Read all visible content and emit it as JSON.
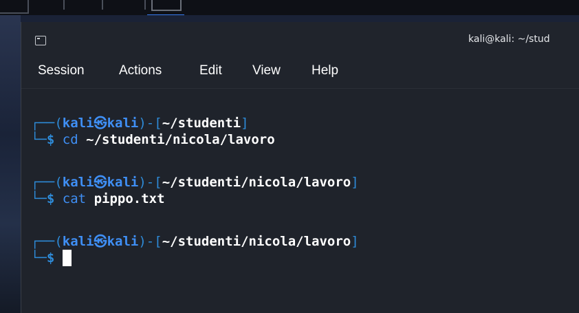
{
  "window": {
    "title": "kali@kali: ~/stud"
  },
  "menu": {
    "session": "Session",
    "actions": "Actions",
    "edit": "Edit",
    "view": "View",
    "help": "Help"
  },
  "terminal": {
    "prompts": [
      {
        "user": "kali",
        "at": "㉿",
        "host": "kali",
        "path": "~/studenti",
        "command": "cd",
        "argument": "~/studenti/nicola/lavoro"
      },
      {
        "user": "kali",
        "at": "㉿",
        "host": "kali",
        "path": "~/studenti/nicola/lavoro",
        "command": "cat",
        "argument": "pippo.txt"
      },
      {
        "user": "kali",
        "at": "㉿",
        "host": "kali",
        "path": "~/studenti/nicola/lavoro",
        "command": "",
        "argument": ""
      }
    ],
    "symbols": {
      "corner_top": "┌──",
      "corner_bottom": "└─",
      "open_paren": "(",
      "close_paren": ")",
      "dash": "-",
      "open_bracket": "[",
      "close_bracket": "]",
      "dollar": "$"
    }
  },
  "colors": {
    "prompt_blue": "#3f8ff5",
    "frame_blue": "#2e8bd8",
    "background": "#1f232b",
    "taskbar_active": "#367bf0"
  }
}
